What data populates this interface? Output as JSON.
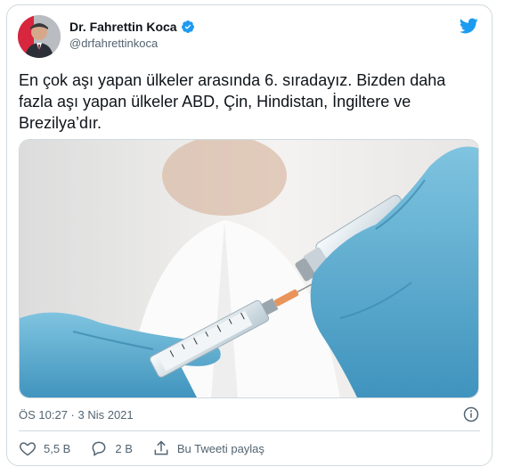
{
  "author": {
    "name": "Dr. Fahrettin Koca",
    "handle": "@drfahrettinkoca",
    "verified": true
  },
  "tweet": {
    "text": "En çok aşı yapan ülkeler arasında 6. sıradayız. Bizden daha fazla aşı yapan ülkeler ABD, Çin, Hindistan, İngiltere ve Brezilya’dır.",
    "timestamp": "ÖS 10:27 · 3 Nis 2021"
  },
  "actions": {
    "likes": "5,5 B",
    "replies": "2 B",
    "share_label": "Bu Tweeti paylaş"
  },
  "colors": {
    "brand": "#1d9bf0",
    "muted": "#536471",
    "border": "#cfd9de"
  },
  "icons": [
    "twitter-bird-icon",
    "verified-badge-icon",
    "info-icon",
    "heart-icon",
    "reply-icon",
    "share-icon"
  ]
}
